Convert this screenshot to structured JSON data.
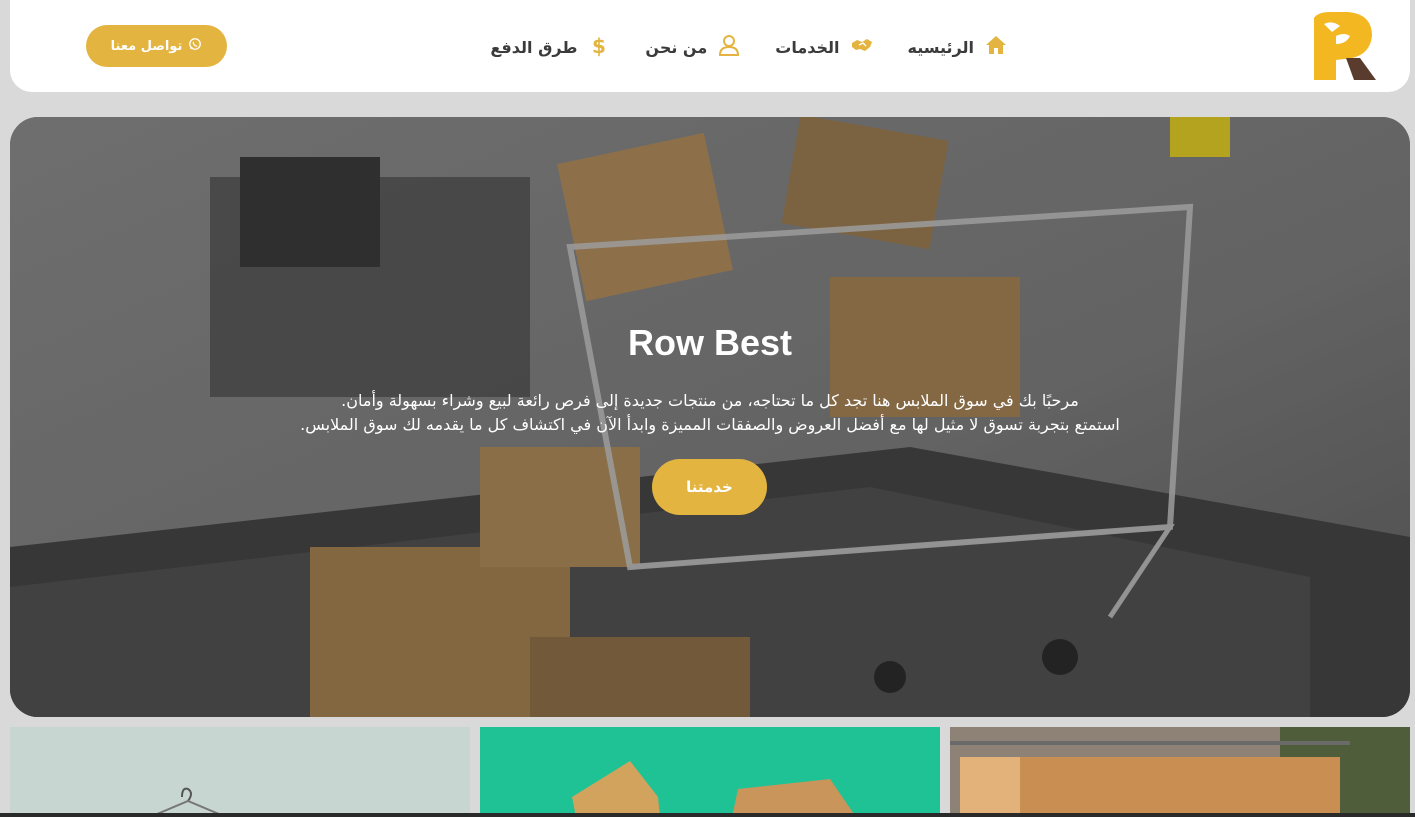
{
  "nav": {
    "items": [
      {
        "label": "الرئيسيه",
        "icon": "home-icon"
      },
      {
        "label": "الخدمات",
        "icon": "handshake-icon"
      },
      {
        "label": "من نحن",
        "icon": "user-icon"
      },
      {
        "label": "طرق الدفع",
        "icon": "dollar-icon"
      }
    ],
    "contact_label": "تواصل معنا",
    "contact_icon": "whatsapp-icon"
  },
  "hero": {
    "title": "Row Best",
    "line1": "مرحبًا بك في سوق الملابس هنا تجد كل ما تحتاجه، من منتجات جديدة إلى فرص رائعة لبيع وشراء بسهولة وأمان.",
    "line2": "استمتع بتجربة تسوق لا مثيل لها مع أفضل العروض والصفقات المميزة وابدأ الآن في اكتشاف كل ما يقدمه لك سوق الملابس.",
    "button_label": "خدمتنا"
  },
  "colors": {
    "accent": "#e4b440",
    "text_dark": "#3b3b3b",
    "page_bg": "#d9d9d9",
    "card_green": "#1fc294"
  }
}
